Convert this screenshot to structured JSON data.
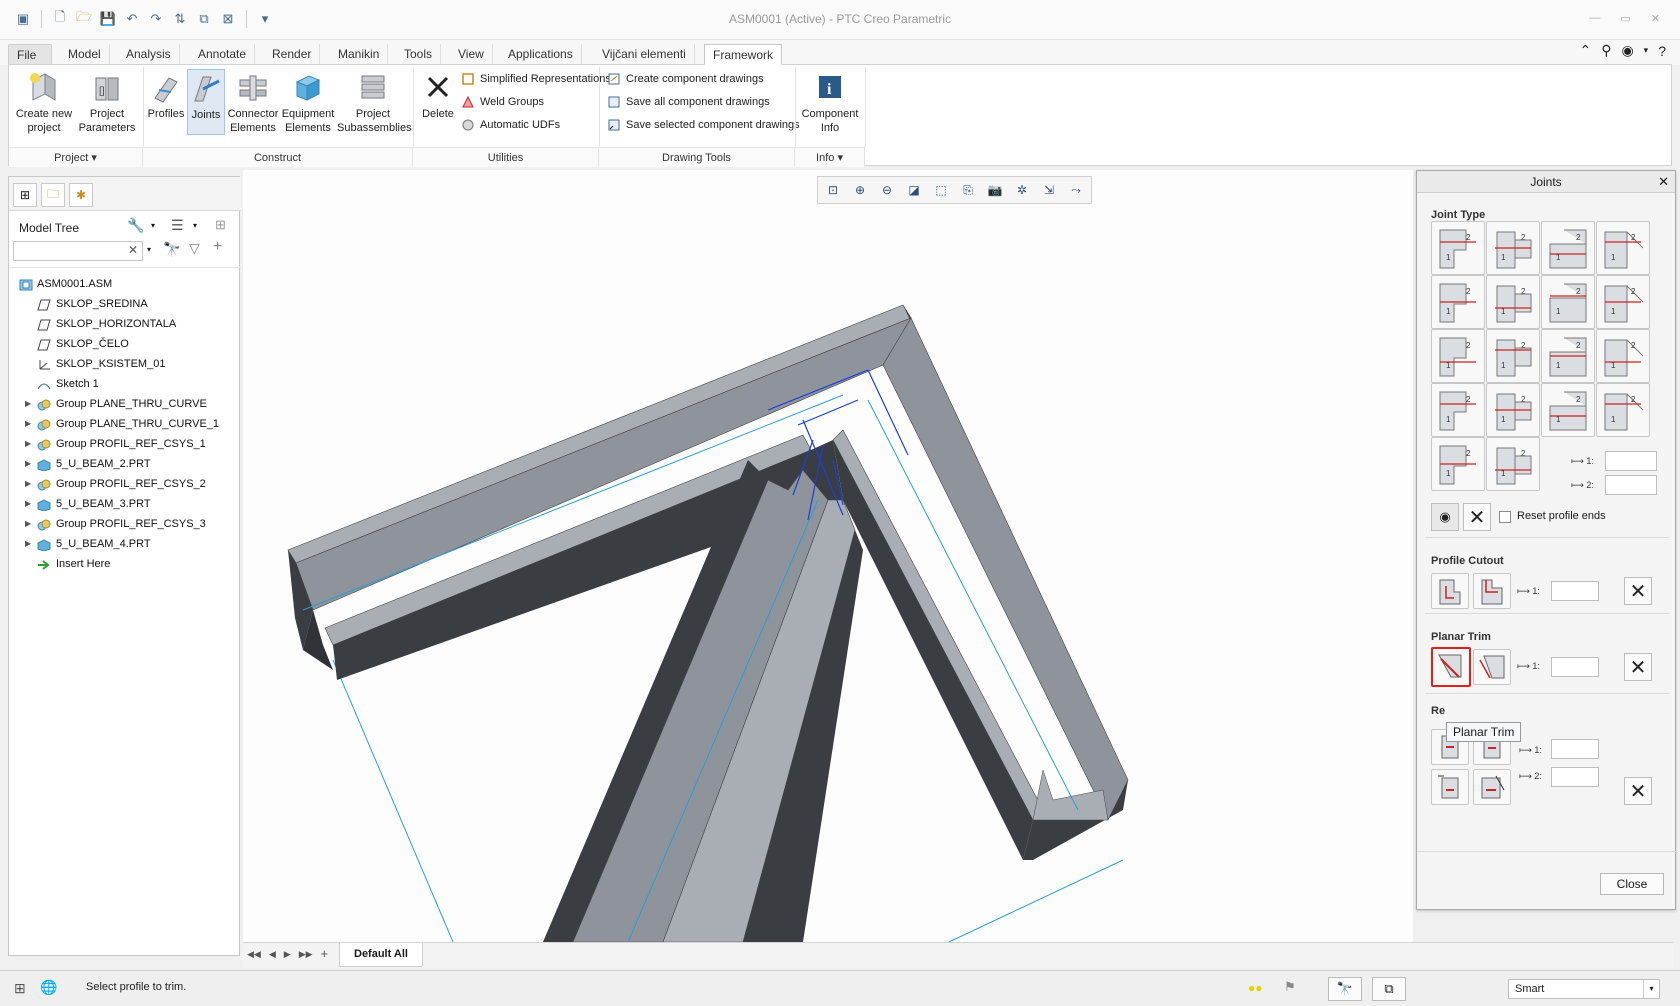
{
  "window": {
    "title": "ASM0001 (Active) - PTC Creo Parametric"
  },
  "ribbon_tabs": [
    "File",
    "Model",
    "Analysis",
    "Annotate",
    "Render",
    "Manikin",
    "Tools",
    "View",
    "Applications",
    "Vijčani elementi",
    "Framework"
  ],
  "active_tab": "Framework",
  "ribbon": {
    "project": {
      "create_new_project": [
        "Create new",
        "project"
      ],
      "project_parameters": [
        "Project",
        "Parameters"
      ],
      "group_label": "Project"
    },
    "construct": {
      "profiles": "Profiles",
      "joints": "Joints",
      "connector_elements": [
        "Connector",
        "Elements"
      ],
      "equipment_elements": [
        "Equipment",
        "Elements"
      ],
      "project_subassemblies": [
        "Project",
        "Subassemblies"
      ],
      "group_label": "Construct"
    },
    "utilities": {
      "delete": "Delete",
      "simplified_representations": "Simplified Representations",
      "weld_groups": "Weld Groups",
      "automatic_udfs": "Automatic UDFs",
      "group_label": "Utilities"
    },
    "drawing_tools": {
      "create_component_drawings": "Create component drawings",
      "save_all_component_drawings": "Save all component drawings",
      "save_selected_component_drawings": "Save selected component drawings",
      "group_label": "Drawing Tools"
    },
    "info": {
      "component_info": [
        "Component",
        "Info"
      ],
      "group_label": "Info"
    }
  },
  "model_tree": {
    "header": "Model Tree",
    "items": [
      {
        "label": "ASM0001.ASM",
        "icon": "assembly-icon",
        "level": 0,
        "expandable": false
      },
      {
        "label": "SKLOP_SREDINA",
        "icon": "datum-plane-icon",
        "level": 1,
        "expandable": false
      },
      {
        "label": "SKLOP_HORIZONTALA",
        "icon": "datum-plane-icon",
        "level": 1,
        "expandable": false
      },
      {
        "label": "SKLOP_ČELO",
        "icon": "datum-plane-icon",
        "level": 1,
        "expandable": false
      },
      {
        "label": "SKLOP_KSISTEM_01",
        "icon": "coordinate-system-icon",
        "level": 1,
        "expandable": false
      },
      {
        "label": "Sketch 1",
        "icon": "sketch-icon",
        "level": 1,
        "expandable": false
      },
      {
        "label": "Group PLANE_THRU_CURVE",
        "icon": "group-icon",
        "level": 1,
        "expandable": true
      },
      {
        "label": "Group PLANE_THRU_CURVE_1",
        "icon": "group-icon",
        "level": 1,
        "expandable": true
      },
      {
        "label": "Group PROFIL_REF_CSYS_1",
        "icon": "group-icon",
        "level": 1,
        "expandable": true
      },
      {
        "label": "5_U_BEAM_2.PRT",
        "icon": "part-icon",
        "level": 1,
        "expandable": true
      },
      {
        "label": "Group PROFIL_REF_CSYS_2",
        "icon": "group-icon",
        "level": 1,
        "expandable": true
      },
      {
        "label": "5_U_BEAM_3.PRT",
        "icon": "part-icon",
        "level": 1,
        "expandable": true
      },
      {
        "label": "Group PROFIL_REF_CSYS_3",
        "icon": "group-icon",
        "level": 1,
        "expandable": true
      },
      {
        "label": "5_U_BEAM_4.PRT",
        "icon": "part-icon",
        "level": 1,
        "expandable": true
      },
      {
        "label": "Insert Here",
        "icon": "insert-arrow-icon",
        "level": 1,
        "expandable": false
      }
    ]
  },
  "joints_dialog": {
    "title": "Joints",
    "joint_type_label": "Joint Type",
    "dim1_label": "1:",
    "dim2_label": "2:",
    "reset_profile_ends_label": "Reset profile ends",
    "profile_cutout_label": "Profile Cutout",
    "planar_trim_label": "Planar Trim",
    "rep_label_partial": "Re",
    "tooltip": "Planar Trim",
    "close_button": "Close"
  },
  "sheet_tab": "Default All",
  "status": {
    "message": "Select profile to trim.",
    "filter": "Smart"
  },
  "colors": {
    "accent_blue": "#2a5a8a",
    "beam_top": "#8f949c",
    "beam_side": "#3a3d42",
    "highlight_red": "#e0201c",
    "reference_line": "#2b9dd1"
  }
}
